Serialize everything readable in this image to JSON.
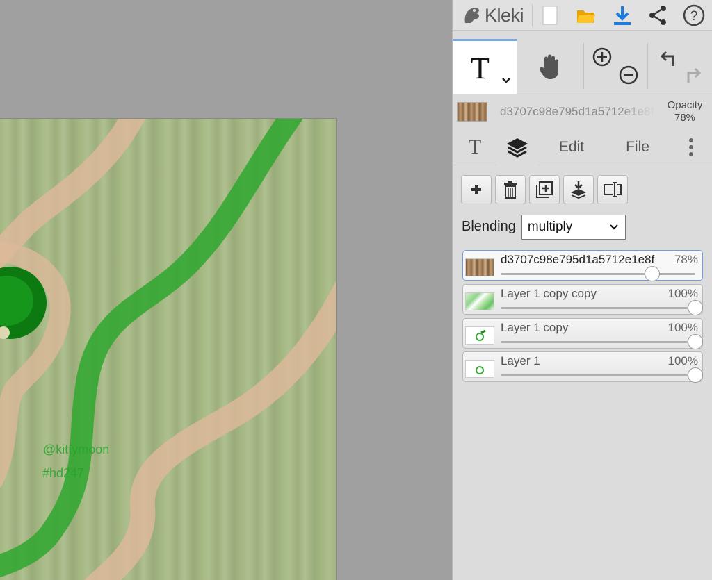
{
  "app": {
    "name": "Kleki"
  },
  "canvas": {
    "texts": [
      "@kittymoon",
      "#hd247"
    ],
    "colors": {
      "background": "#a5b882",
      "path": "#dcb99a",
      "stroke": "#2fa72f",
      "dark": "#0c7a10"
    }
  },
  "topbar": {
    "icons": [
      "new-file-icon",
      "open-folder-icon",
      "download-icon",
      "share-icon",
      "help-icon"
    ]
  },
  "tools": {
    "active": "text",
    "icons": [
      "text-tool-icon",
      "hand-tool-icon",
      "zoom-in-icon",
      "zoom-out-icon",
      "undo-icon",
      "redo-icon"
    ]
  },
  "current_layer": {
    "name": "d3707c98e795d1a5712e1e8f",
    "opacity_label": "Opacity",
    "opacity_value": "78%"
  },
  "tabs": [
    {
      "id": "text",
      "label": "T"
    },
    {
      "id": "layers",
      "label": ""
    },
    {
      "id": "edit",
      "label": "Edit"
    },
    {
      "id": "file",
      "label": "File"
    }
  ],
  "layer_tools": [
    "add-layer-icon",
    "delete-layer-icon",
    "duplicate-layer-icon",
    "merge-down-icon",
    "rename-layer-icon"
  ],
  "blending": {
    "label": "Blending",
    "value": "multiply"
  },
  "layers": [
    {
      "name": "d3707c98e795d1a5712e1e8f",
      "opacity": "78%",
      "level": 0.78,
      "active": true
    },
    {
      "name": "Layer 1 copy copy",
      "opacity": "100%",
      "level": 1.0,
      "active": false
    },
    {
      "name": "Layer 1 copy",
      "opacity": "100%",
      "level": 1.0,
      "active": false
    },
    {
      "name": "Layer 1",
      "opacity": "100%",
      "level": 1.0,
      "active": false
    }
  ]
}
